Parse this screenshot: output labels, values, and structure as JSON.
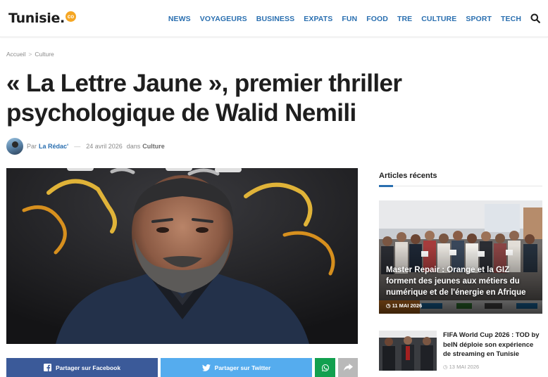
{
  "site": {
    "logo_text": "Tunisie.",
    "logo_badge": "co"
  },
  "nav": {
    "items": [
      "NEWS",
      "VOYAGEURS",
      "BUSINESS",
      "EXPATS",
      "FUN",
      "FOOD",
      "TRE",
      "CULTURE",
      "SPORT",
      "TECH"
    ]
  },
  "breadcrumb": {
    "home": "Accueil",
    "separator": ">",
    "current": "Culture"
  },
  "article": {
    "title": "« La Lettre Jaune », premier thriller psychologique de Walid Nemili",
    "by_prefix": "Par",
    "author": "La Rédac'",
    "dash": "—",
    "date": "24 avril 2026",
    "in_prefix": "dans",
    "category": "Culture"
  },
  "share": {
    "facebook": "Partager sur Facebook",
    "twitter": "Partager sur Twitter"
  },
  "sidebar": {
    "heading": "Articles récents",
    "featured": {
      "title": "Master Repair : Orange et la GIZ forment des jeunes aux métiers du numérique et de l'énergie en Afrique",
      "date": "11 MAI 2026"
    },
    "small": {
      "title": "FIFA World Cup 2026 : TOD by beIN déploie son expérience de streaming en Tunisie",
      "date": "13 MAI 2026"
    }
  },
  "colors": {
    "accent": "#2a6fb0",
    "facebook": "#3b5a99",
    "twitter": "#55acee",
    "whatsapp": "#12a04f",
    "more": "#b9b9b9"
  }
}
